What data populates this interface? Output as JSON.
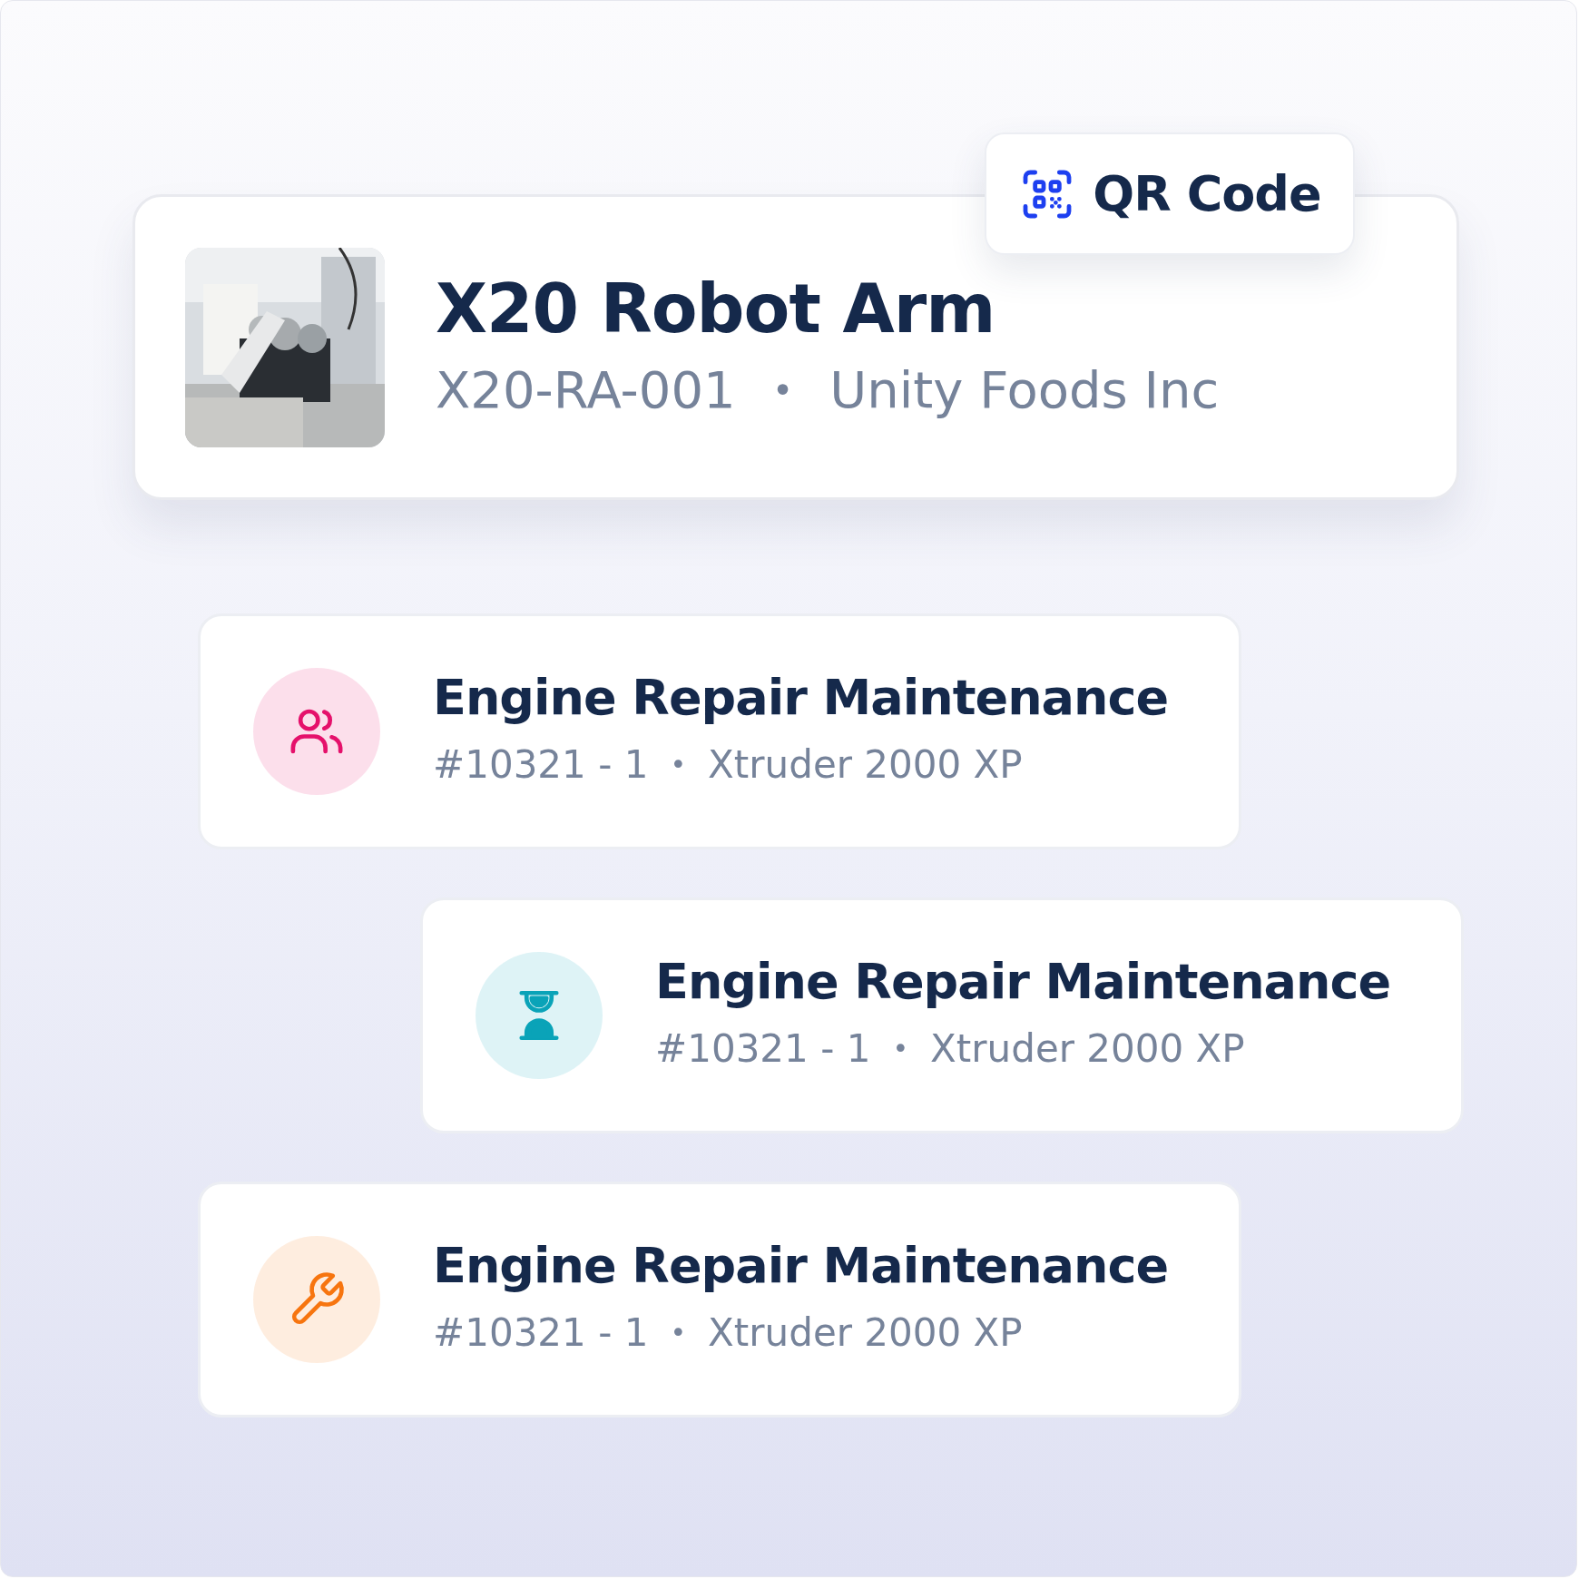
{
  "asset": {
    "name": "X20 Robot Arm",
    "code": "X20-RA-001",
    "separator": "•",
    "company": "Unity Foods Inc"
  },
  "qr_button": {
    "label": "QR Code"
  },
  "work_orders": [
    {
      "kind": "team",
      "color": "#e5116b",
      "title": "Engine Repair Maintenance",
      "number": "#10321 - 1",
      "separator": "•",
      "machine": "Xtruder 2000 XP"
    },
    {
      "kind": "pending",
      "color": "#0aa3b8",
      "title": "Engine Repair Maintenance",
      "number": "#10321 - 1",
      "separator": "•",
      "machine": "Xtruder 2000 XP"
    },
    {
      "kind": "repair",
      "color": "#f7750f",
      "title": "Engine Repair Maintenance",
      "number": "#10321 - 1",
      "separator": "•",
      "machine": "Xtruder 2000 XP"
    }
  ]
}
